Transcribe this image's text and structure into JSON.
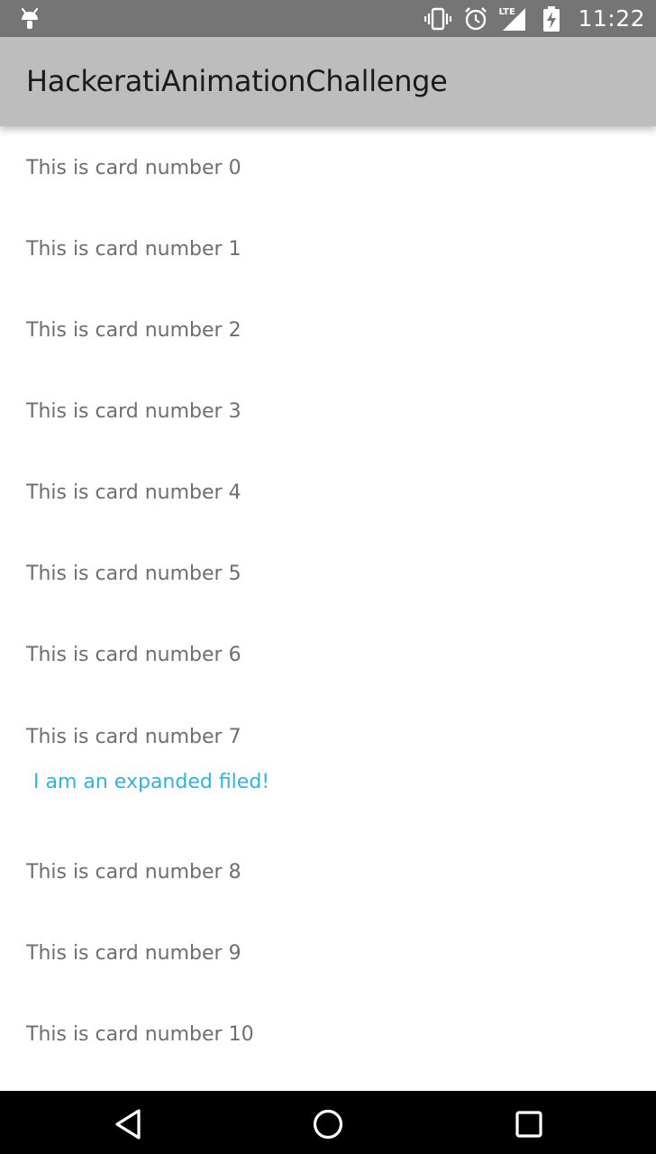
{
  "status_bar": {
    "time": "11:22",
    "network_label": "LTE",
    "icons": [
      "android-debug-icon",
      "vibrate-icon",
      "alarm-icon",
      "signal-icon",
      "battery-charging-icon"
    ]
  },
  "toolbar": {
    "title": "HackeratiAnimationChallenge"
  },
  "cards": [
    {
      "label": "This is card number 0"
    },
    {
      "label": "This is card number 1"
    },
    {
      "label": "This is card number 2"
    },
    {
      "label": "This is card number 3"
    },
    {
      "label": "This is card number 4"
    },
    {
      "label": "This is card number 5"
    },
    {
      "label": "This is card number 6"
    },
    {
      "label": "This is card number 7",
      "expanded_text": "I am an expanded filed!"
    },
    {
      "label": "This is card number 8"
    },
    {
      "label": "This is card number 9"
    },
    {
      "label": "This is card number 10"
    }
  ],
  "nav_bar": {
    "buttons": [
      "back-icon",
      "home-icon",
      "recents-icon"
    ]
  },
  "colors": {
    "status_bar": "#757575",
    "toolbar": "#bdbdbd",
    "card_text": "#6e6e6e",
    "expanded_text": "#2fb3e0",
    "nav_bar": "#000000"
  }
}
